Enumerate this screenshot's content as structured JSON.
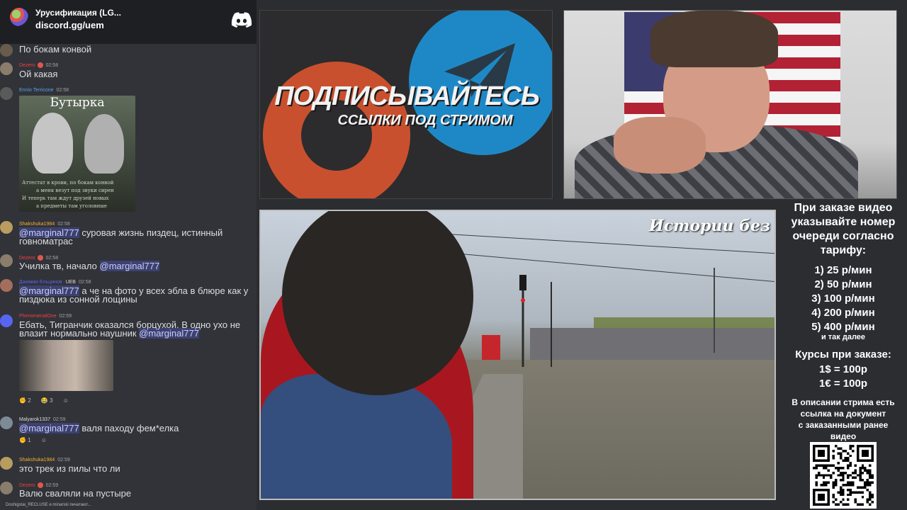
{
  "server": {
    "name": "Урусификация (LG...",
    "invite": "discord.gg/uem"
  },
  "messages": [
    {
      "text": "По бокам конвой"
    },
    {
      "author": "Dezero",
      "time": "02:58",
      "text": "Ой какая"
    },
    {
      "author": "Ennio Terricone",
      "time": "02:58",
      "image_title": "Бутырка",
      "image_lines": [
        "Аттестат в крови, по бокам конвой",
        "а меня везут под звуки сирен",
        "И теперь там ждут друзей новых",
        "а предметы там уголовные"
      ]
    },
    {
      "author": "Shakshuka1984",
      "time": "02:58",
      "mention": "@marginal777",
      "text": "суровая жизнь пиздец, истинный говноматрас"
    },
    {
      "author": "Dezero",
      "time": "02:58",
      "text": "Училка тв, начало",
      "mention": "@marginal777"
    },
    {
      "author": "Джимми Ельцинов",
      "tag": "UEB",
      "time": "02:58",
      "mention": "@marginal777",
      "text": "а че на фото у всех эбла в блюре как у пиздюка из сонной лощины"
    },
    {
      "author": "PhenomenalOne",
      "time": "02:59",
      "text": "Ебать, Тигранчик оказался борцухой. В одно ухо не влазит нормально наушник",
      "mention": "@marginal777",
      "reactions": [
        "2",
        "3"
      ]
    },
    {
      "author": "Malyarok1337",
      "time": "02:59",
      "mention": "@marginal777",
      "text": "валя паходу фем*елка",
      "reactions": [
        "1"
      ]
    },
    {
      "author": "Shakshuka1984",
      "time": "02:59",
      "text": "это трек из пилы что ли"
    },
    {
      "author": "Dezero",
      "time": "02:59",
      "text": "Валю сваляли на пустыре"
    }
  ],
  "typing": "Doshigstai_RECLUSE и minarski печатают...",
  "promo": {
    "title": "ПОДПИСЫВАЙТЕСЬ",
    "subtitle": "ССЫЛКИ ПОД СТРИМОМ"
  },
  "video": {
    "title": "Истории без сахара"
  },
  "info": {
    "header": [
      "При заказе видео",
      "указывайте номер",
      "очереди согласно",
      "тарифу:"
    ],
    "tariffs": [
      "1) 25 р/мин",
      "2) 50 р/мин",
      "3) 100 р/мин",
      "4) 200 р/мин",
      "5) 400 р/мин"
    ],
    "tariff_more": "и так далее",
    "rates_header": "Курсы при заказе:",
    "rates": [
      "1$ = 100р",
      "1€ = 100р"
    ],
    "description": [
      "В описании стрима есть",
      "ссылка на документ",
      "с заказанными ранее",
      "видео"
    ]
  },
  "colors": {
    "chat_bg": "#313338",
    "mention_bg": "#3c4270",
    "author_orange": "#f0b232",
    "author_red": "#f23f43",
    "author_blue": "#5aa1ee",
    "promo_orange": "#c9502e",
    "promo_blue": "#1e88c7"
  }
}
